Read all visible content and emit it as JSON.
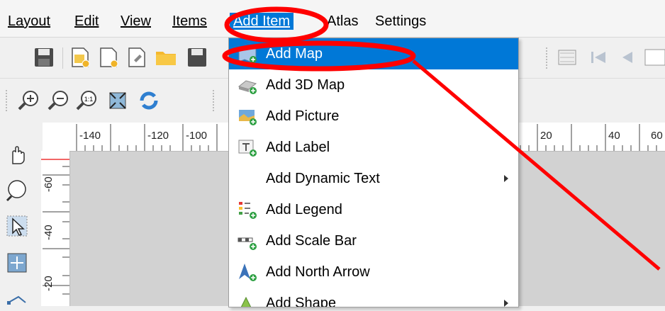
{
  "menubar": {
    "items": [
      {
        "label": "Layout",
        "mnemonic_index": 0
      },
      {
        "label": "Edit",
        "mnemonic_index": 0
      },
      {
        "label": "View",
        "mnemonic_index": 0
      },
      {
        "label": "Items",
        "mnemonic_index": 0
      },
      {
        "label": "Add Item",
        "mnemonic_index": 0
      },
      {
        "label": "Atlas",
        "mnemonic_index": 0
      },
      {
        "label": "Settings",
        "mnemonic_index": 0
      }
    ]
  },
  "dropdown": {
    "items": [
      {
        "label": "Add Map",
        "icon": "map-icon",
        "highlighted": true
      },
      {
        "label": "Add 3D Map",
        "icon": "3d-map-icon"
      },
      {
        "label": "Add Picture",
        "icon": "picture-icon"
      },
      {
        "label": "Add Label",
        "icon": "label-icon"
      },
      {
        "label": "Add Dynamic Text",
        "icon": "",
        "submenu": true
      },
      {
        "label": "Add Legend",
        "icon": "legend-icon"
      },
      {
        "label": "Add Scale Bar",
        "icon": "scale-bar-icon"
      },
      {
        "label": "Add North Arrow",
        "icon": "north-arrow-icon"
      },
      {
        "label": "Add Shape",
        "icon": "shape-icon",
        "submenu": true
      }
    ]
  },
  "ruler_top": {
    "ticks": [
      "-140",
      "-120",
      "-100",
      "20",
      "40",
      "60"
    ]
  },
  "ruler_left": {
    "ticks": [
      "-60",
      "-40",
      "-20"
    ]
  },
  "colors": {
    "highlight": "#0078d7",
    "annotation": "#ff0000"
  }
}
